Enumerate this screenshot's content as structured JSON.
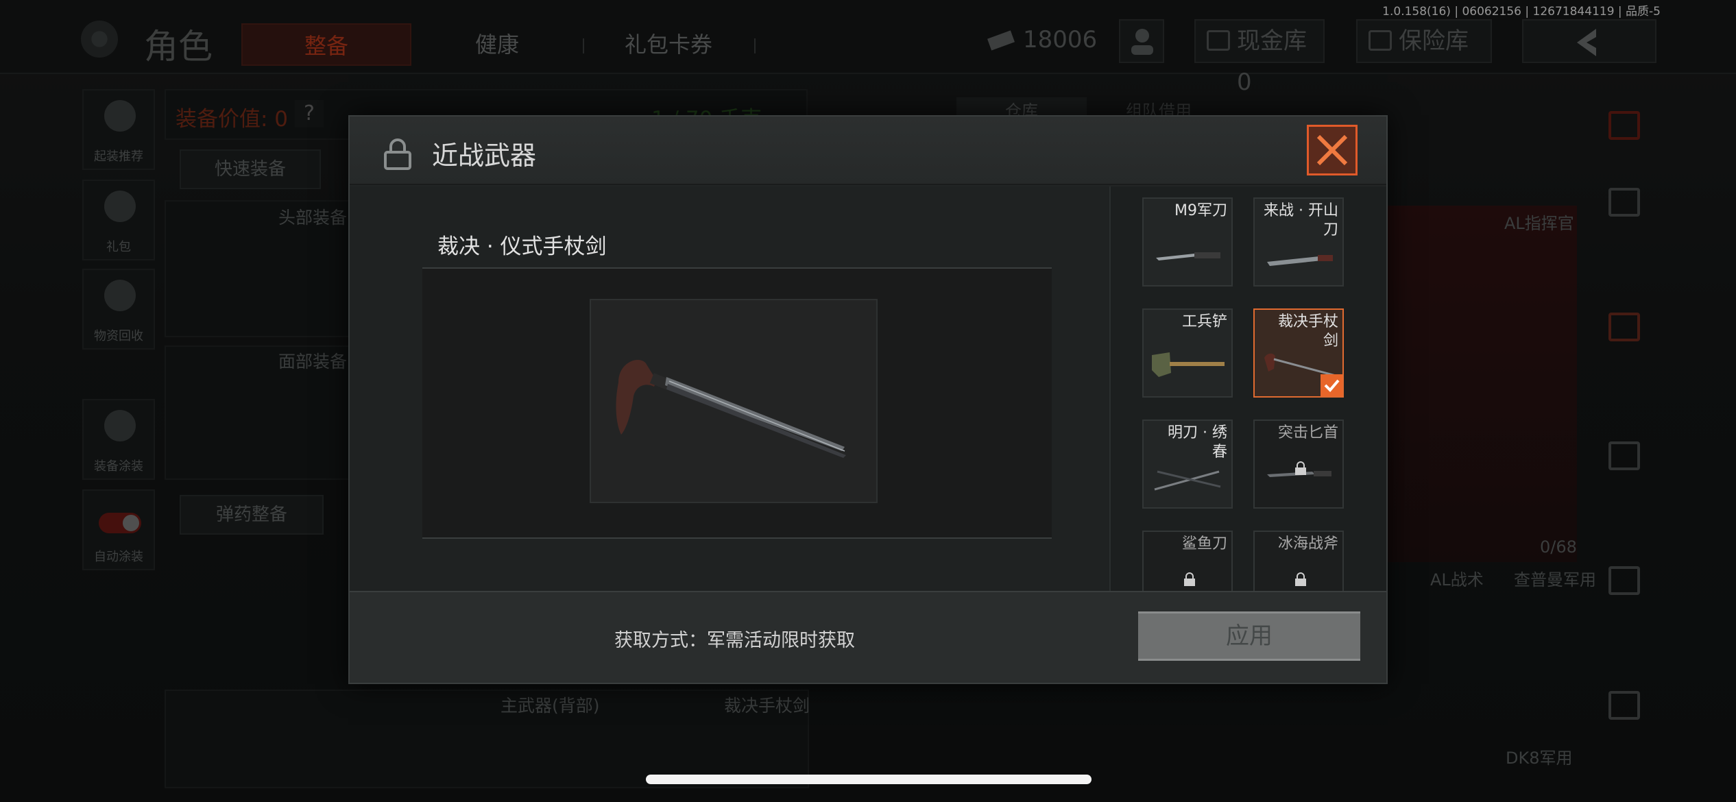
{
  "version_text": "1.0.158(16) | 06062156 | 12671844119 | 品质-5",
  "header": {
    "title": "角色",
    "tabs": [
      "整备",
      "健康",
      "礼包卡券"
    ],
    "money": "18006",
    "cash_vault": "现金库 0",
    "safe": "保险库"
  },
  "sidebar": {
    "items": [
      "起装推荐",
      "礼包",
      "物资回收",
      "装备涂装",
      "自动涂装"
    ]
  },
  "equip_panel": {
    "value_label": "装备值:",
    "value_label_full": "装备价值: 0",
    "capacity": "1 / 70 千克",
    "quick_equip": "快速装备",
    "head_slot": "头部装备",
    "face_slot": "面部装备",
    "ammo_equip": "弹药整备",
    "main_weapon_slot": "主武器(背部)",
    "melee_slot_value": "裁决手杖剑"
  },
  "warehouse": {
    "tabs": [
      "仓库",
      "组队借用"
    ],
    "items": [
      "AL指挥官",
      "AL战术",
      "查普曼军用",
      "DK8军用"
    ],
    "count": "0/68"
  },
  "modal": {
    "title": "近战武器",
    "weapon_name": "裁决 · 仪式手杖剑",
    "obtain": "获取方式：军需活动限时获取",
    "apply": "应用",
    "items": [
      {
        "name": "M9军刀",
        "state": "owned"
      },
      {
        "name": "来战 · 开山刀",
        "state": "owned"
      },
      {
        "name": "工兵铲",
        "state": "owned"
      },
      {
        "name": "裁决手杖剑",
        "state": "selected"
      },
      {
        "name": "明刀 · 绣春",
        "state": "owned"
      },
      {
        "name": "突击匕首",
        "state": "locked"
      },
      {
        "name": "鲨鱼刀",
        "state": "locked"
      },
      {
        "name": "冰海战斧",
        "state": "locked"
      }
    ]
  },
  "colors": {
    "accent": "#e8662a",
    "close_border": "#e05a2a"
  }
}
